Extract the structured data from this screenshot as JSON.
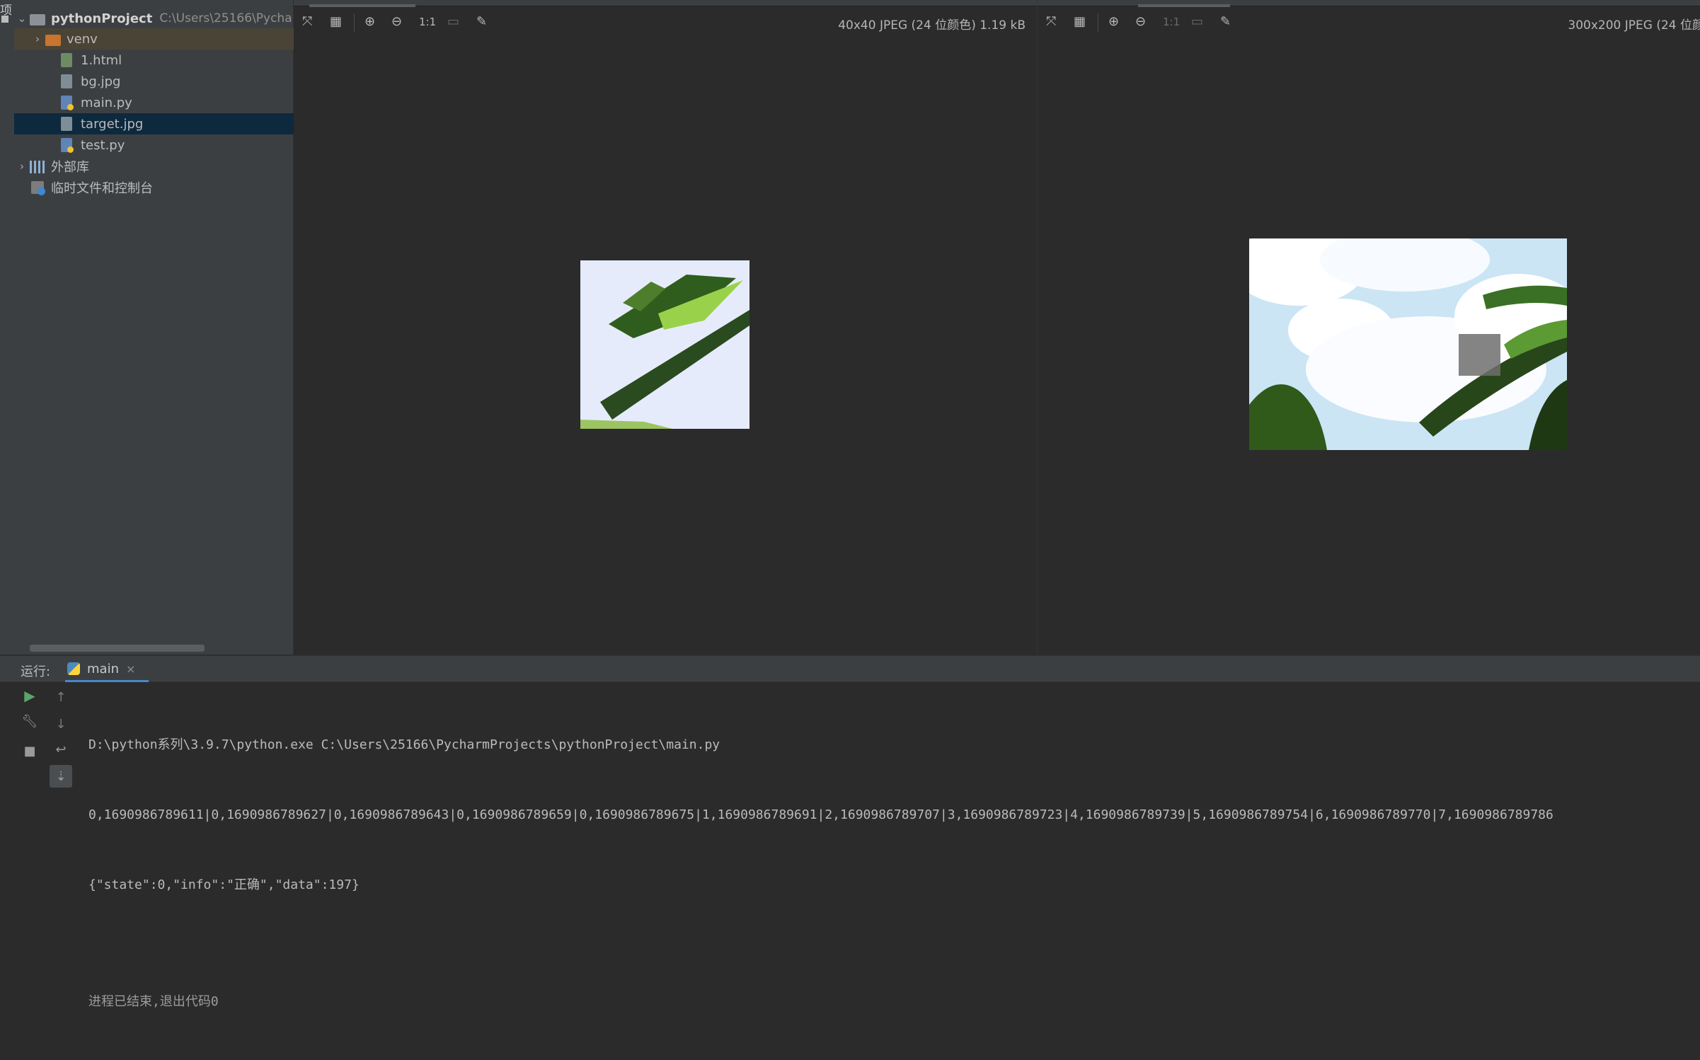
{
  "project_panel": {
    "root": {
      "name": "pythonProject",
      "path": "C:\\Users\\25166\\Pycha"
    },
    "items": [
      {
        "name": "venv",
        "type": "folder"
      },
      {
        "name": "1.html",
        "type": "html"
      },
      {
        "name": "bg.jpg",
        "type": "image"
      },
      {
        "name": "main.py",
        "type": "python"
      },
      {
        "name": "target.jpg",
        "type": "image",
        "selected": true
      },
      {
        "name": "test.py",
        "type": "python"
      }
    ],
    "external_libraries": "外部库",
    "scratches": "临时文件和控制台"
  },
  "viewer_left": {
    "info": "40x40 JPEG (24 位颜色) 1.19 kB"
  },
  "viewer_right": {
    "info": "300x200 JPEG (24 位颜"
  },
  "toolbar": {
    "one_to_one": "1:1"
  },
  "run_panel": {
    "label": "运行:",
    "tab": "main",
    "console": [
      "D:\\python系列\\3.9.7\\python.exe C:\\Users\\25166\\PycharmProjects\\pythonProject\\main.py",
      "0,1690986789611|0,1690986789627|0,1690986789643|0,1690986789659|0,1690986789675|1,1690986789691|2,1690986789707|3,1690986789723|4,1690986789739|5,1690986789754|6,1690986789770|7,1690986789786",
      "{\"state\":0,\"info\":\"正确\",\"data\":197}",
      "",
      "进程已结束,退出代码0"
    ]
  }
}
